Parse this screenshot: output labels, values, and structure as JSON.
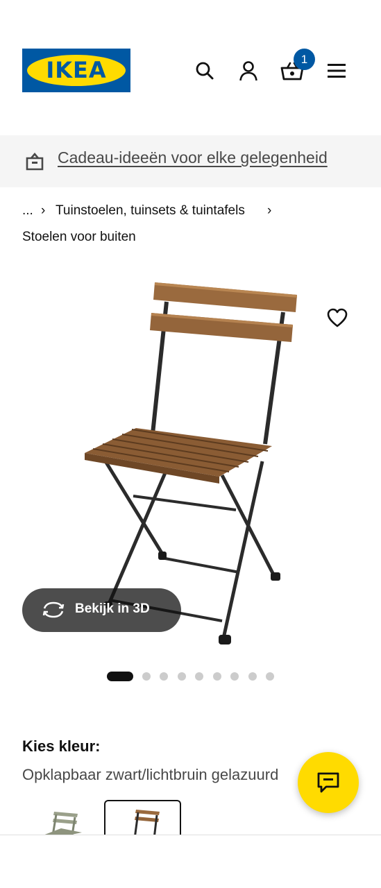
{
  "header": {
    "logo_text": "IKEA",
    "cart_count": "1",
    "icons": [
      "search-icon",
      "account-icon",
      "cart-icon",
      "menu-icon"
    ]
  },
  "promo": {
    "icon": "gift-box-icon",
    "link_text": "Cadeau-ideeën voor elke gelegenheid"
  },
  "breadcrumb": {
    "ellipsis": "...",
    "separator": "›",
    "items": [
      "Tuinstoelen, tuinsets & tuintafels",
      "Stoelen voor buiten"
    ]
  },
  "product": {
    "image_icon": "folding-chair-image",
    "favorite_icon": "heart-icon",
    "view3d_label": "Bekijk in 3D",
    "view3d_icon": "rotate-3d-icon",
    "image_count": 10,
    "active_image": 1
  },
  "color_selector": {
    "heading": "Kies kleur:",
    "selected_value": "Opklapbaar zwart/lichtbruin gelazuurd",
    "swatches": [
      "swatch-grey-green",
      "swatch-black-lightbrown"
    ]
  },
  "chat": {
    "icon": "chat-icon"
  },
  "colors": {
    "ikea_blue": "#0058a3",
    "ikea_yellow": "#ffdb00",
    "promo_bg": "#f5f5f5",
    "text": "#111111"
  }
}
